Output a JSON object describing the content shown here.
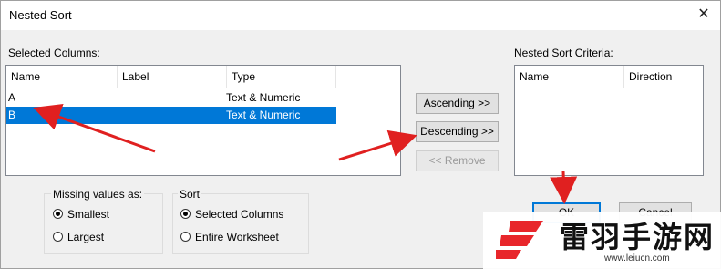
{
  "window": {
    "title": "Nested Sort",
    "close_glyph": "✕"
  },
  "selected_columns": {
    "label": "Selected Columns:",
    "headers": [
      "Name",
      "Label",
      "Type"
    ],
    "rows": [
      {
        "name": "A",
        "label": "",
        "type": "Text & Numeric",
        "selected": false
      },
      {
        "name": "B",
        "label": "",
        "type": "Text & Numeric",
        "selected": true
      }
    ]
  },
  "buttons": {
    "ascending": "Ascending >>",
    "descending": "Descending >>",
    "remove": "<< Remove",
    "ok": "OK",
    "cancel": "Cancel"
  },
  "criteria": {
    "label": "Nested Sort Criteria:",
    "headers": [
      "Name",
      "Direction"
    ]
  },
  "missing_values": {
    "title": "Missing values as:",
    "options": [
      {
        "label": "Smallest",
        "checked": true
      },
      {
        "label": "Largest",
        "checked": false
      }
    ]
  },
  "sort": {
    "title": "Sort",
    "options": [
      {
        "label": "Selected Columns",
        "checked": true
      },
      {
        "label": "Entire Worksheet",
        "checked": false
      }
    ]
  },
  "watermark": {
    "brand": "雷羽手游网",
    "url": "www.leiucn.com"
  },
  "colors": {
    "selection": "#0078d7",
    "annotation_arrow": "#e02020",
    "default_button_border": "#0078d7"
  }
}
